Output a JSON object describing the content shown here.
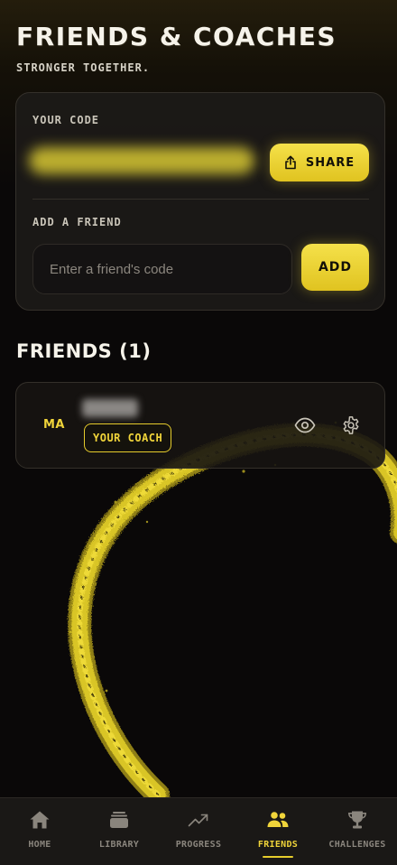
{
  "header": {
    "title": "FRIENDS & COACHES",
    "subtitle": "STRONGER TOGETHER."
  },
  "code_card": {
    "your_code_label": "YOUR CODE",
    "share_label": "SHARE",
    "add_friend_label": "ADD A FRIEND",
    "input_placeholder": "Enter a friend's code",
    "add_label": "ADD"
  },
  "friends": {
    "heading": "FRIENDS (1)",
    "items": [
      {
        "initials": "MA",
        "badge": "YOUR COACH"
      }
    ]
  },
  "tabs": [
    {
      "label": "HOME",
      "icon": "home-icon",
      "active": false
    },
    {
      "label": "LIBRARY",
      "icon": "library-icon",
      "active": false
    },
    {
      "label": "PROGRESS",
      "icon": "trending-up-icon",
      "active": false
    },
    {
      "label": "FRIENDS",
      "icon": "users-icon",
      "active": true
    },
    {
      "label": "CHALLENGES",
      "icon": "trophy-icon",
      "active": false
    }
  ],
  "colors": {
    "accent": "#f0d43a",
    "background": "#0a0808",
    "card": "#1c1a18",
    "muted_text": "#8a857d"
  }
}
